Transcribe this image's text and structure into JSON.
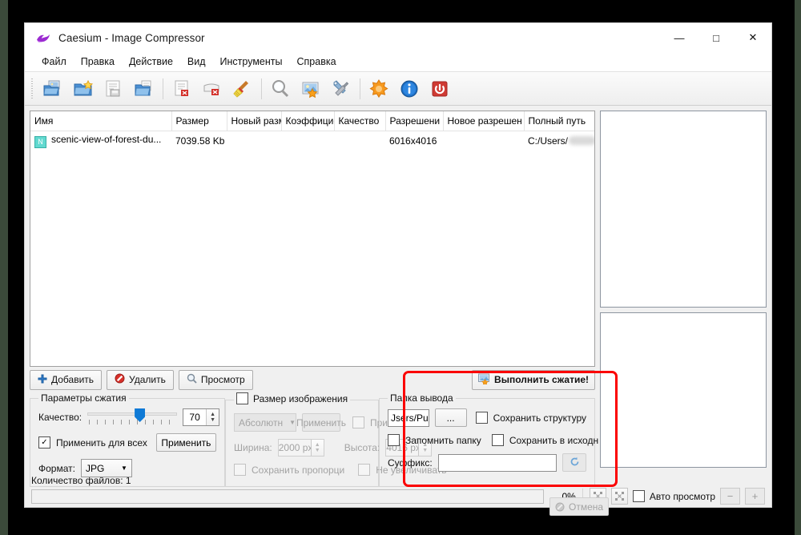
{
  "window": {
    "title": "Caesium - Image Compressor",
    "logo_icon": "caesium-logo-icon",
    "controls": {
      "minimize": "—",
      "maximize": "□",
      "close": "✕"
    }
  },
  "menubar": {
    "items": [
      {
        "label": "Файл",
        "name": "menu-file"
      },
      {
        "label": "Правка",
        "name": "menu-edit"
      },
      {
        "label": "Действие",
        "name": "menu-action"
      },
      {
        "label": "Вид",
        "name": "menu-view"
      },
      {
        "label": "Инструменты",
        "name": "menu-tools"
      },
      {
        "label": "Справка",
        "name": "menu-help"
      }
    ]
  },
  "toolbar": {
    "items": [
      {
        "icon": "open-folder-images-icon"
      },
      {
        "icon": "add-folder-icon"
      },
      {
        "icon": "save-list-icon"
      },
      {
        "icon": "import-folder-icon"
      },
      {
        "sep": true
      },
      {
        "icon": "remove-file-icon"
      },
      {
        "icon": "clear-list-icon"
      },
      {
        "icon": "broom-clean-icon"
      },
      {
        "sep": true
      },
      {
        "icon": "preview-magnifier-icon"
      },
      {
        "icon": "compress-image-icon"
      },
      {
        "icon": "settings-tools-icon"
      },
      {
        "sep": true
      },
      {
        "icon": "star-orange-icon"
      },
      {
        "icon": "info-icon"
      },
      {
        "icon": "power-exit-icon"
      }
    ]
  },
  "file_table": {
    "columns": [
      "Имя",
      "Размер",
      "Новый разм",
      "Коэффицие",
      "Качество",
      "Разрешени",
      "Новое разрешен",
      "Полный путь"
    ],
    "rows": [
      {
        "icon_letter": "N",
        "name": "scenic-view-of-forest-du...",
        "size": "7039.58 Kb",
        "new_size": "",
        "ratio": "",
        "quality": "",
        "resolution": "6016x4016",
        "new_resolution": "",
        "path_prefix": "C:/Users/",
        "path_suffix": "/..."
      }
    ]
  },
  "action_buttons": {
    "add": {
      "label": "Добавить",
      "icon": "plus-blue-icon"
    },
    "remove": {
      "label": "Удалить",
      "icon": "forbidden-red-icon"
    },
    "preview": {
      "label": "Просмотр",
      "icon": "magnifier-icon"
    },
    "compress": {
      "label": "Выполнить сжатие!",
      "icon": "compress-run-icon"
    }
  },
  "compression_params": {
    "legend": "Параметры сжатия",
    "quality_label": "Качество:",
    "quality_value": "70",
    "apply_all_label": "Применить для всех",
    "apply_all_checked": "✓",
    "apply_button": "Применить",
    "format_label": "Формат:",
    "format_value": "JPG"
  },
  "image_size": {
    "legend": "Размер изображения",
    "enabled_checked": "",
    "mode_value": "Абсолютн",
    "apply_button": "Применить",
    "apply_checkbox_label": "Применить",
    "width_label": "Ширина:",
    "width_value": "2000 px",
    "height_label": "Высота:",
    "height_value": "4016 px",
    "keep_aspect_label": "Сохранить пропорци",
    "no_enlarge_label": "Не увеличивать"
  },
  "output_folder": {
    "legend": "Папка вывода",
    "path_value": "Jsers/Public",
    "browse_button": "...",
    "keep_structure_label": "Сохранить структуру",
    "remember_folder_label": "Запомнить папку",
    "save_in_source_label": "Сохранить в исходн",
    "suffix_label": "Суффикс:",
    "suffix_value": "",
    "reset_icon": "refresh-arrow-icon",
    "cancel_button": "Отмена",
    "cancel_icon": "cancel-circle-icon",
    "highlight_color": "#fb0000"
  },
  "statusbar": {
    "file_count_text": "Количество файлов: 1",
    "progress_percent": "0%",
    "progress_value": 0,
    "fit_icon": "fit-in-icon",
    "expand_icon": "fit-out-icon",
    "auto_preview_label": "Авто просмотр",
    "auto_preview_checked": "",
    "zoom_out": "−",
    "zoom_in": "+"
  },
  "preview": {
    "top_panel_name": "original-preview-pane",
    "bottom_panel_name": "compressed-preview-pane"
  }
}
